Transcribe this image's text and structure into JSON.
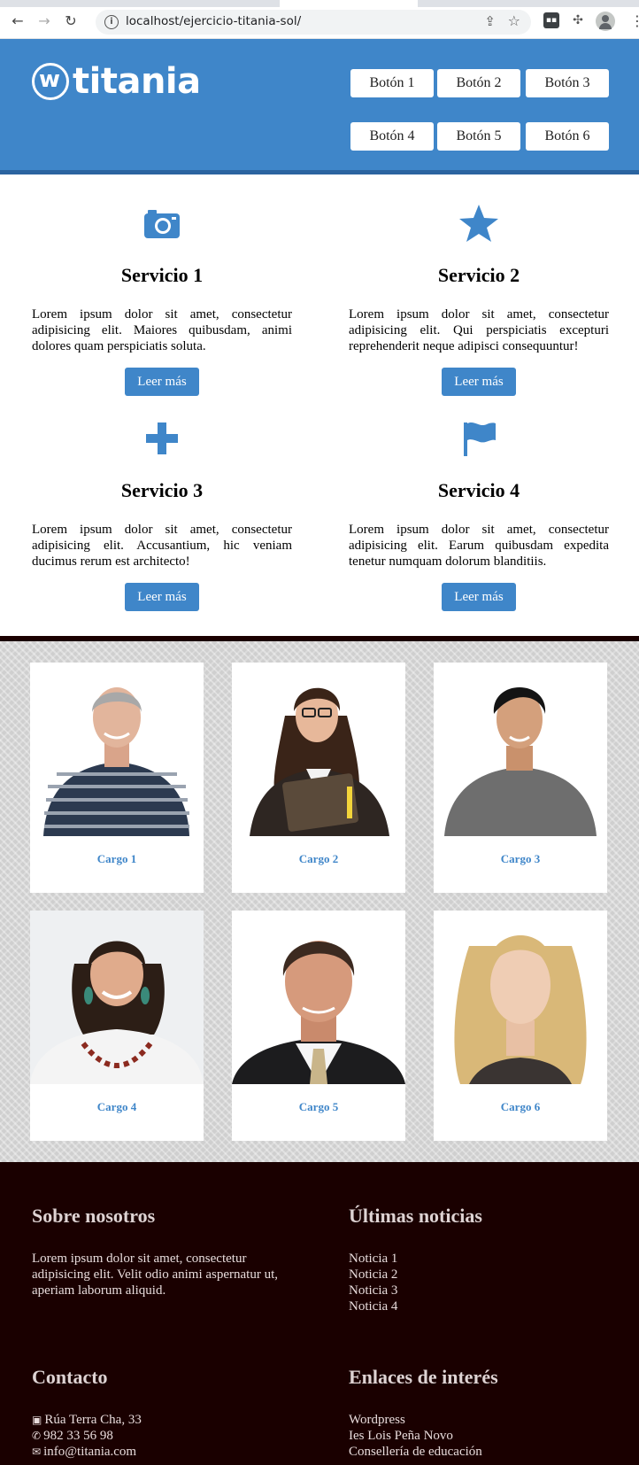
{
  "browser": {
    "url": "localhost/ejercicio-titania-sol/"
  },
  "header": {
    "logo_text": "titania",
    "buttons": [
      "Botón 1",
      "Botón 2",
      "Botón 3",
      "Botón 4",
      "Botón 5",
      "Botón 6"
    ],
    "colors": {
      "primary": "#3f86c9",
      "border": "#2b64a0"
    }
  },
  "services": [
    {
      "icon": "camera-icon",
      "title": "Servicio 1",
      "text": "Lorem ipsum dolor sit amet, consectetur adipisicing elit. Maiores quibusdam, animi dolores quam perspiciatis soluta.",
      "button": "Leer más"
    },
    {
      "icon": "star-icon",
      "title": "Servicio 2",
      "text": "Lorem ipsum dolor sit amet, consectetur adipisicing elit. Qui perspiciatis excepturi reprehenderit neque adipisci consequuntur!",
      "button": "Leer más"
    },
    {
      "icon": "plus-icon",
      "title": "Servicio 3",
      "text": "Lorem ipsum dolor sit amet, consectetur adipisicing elit. Accusantium, hic veniam ducimus rerum est architecto!",
      "button": "Leer más"
    },
    {
      "icon": "flag-icon",
      "title": "Servicio 4",
      "text": "Lorem ipsum dolor sit amet, consectetur adipisicing elit. Earum quibusdam expedita tenetur numquam dolorum blanditiis.",
      "button": "Leer más"
    }
  ],
  "team": [
    {
      "cargo": "Cargo 1"
    },
    {
      "cargo": "Cargo 2"
    },
    {
      "cargo": "Cargo 3"
    },
    {
      "cargo": "Cargo 4"
    },
    {
      "cargo": "Cargo 5"
    },
    {
      "cargo": "Cargo 6"
    }
  ],
  "footer": {
    "about": {
      "title": "Sobre nosotros",
      "text": "Lorem ipsum dolor sit amet, consectetur adipisicing elit. Velit odio animi aspernatur ut, aperiam laborum aliquid."
    },
    "news": {
      "title": "Últimas noticias",
      "items": [
        "Noticia 1",
        "Noticia 2",
        "Noticia 3",
        "Noticia 4"
      ]
    },
    "contact": {
      "title": "Contacto",
      "address": "Rúa Terra Cha, 33",
      "phone": "982 33 56 98",
      "email": "info@titania.com"
    },
    "links": {
      "title": "Enlaces de interés",
      "items": [
        "Wordpress",
        "Ies Lois Peña Novo",
        "Consellería de educación"
      ]
    }
  }
}
